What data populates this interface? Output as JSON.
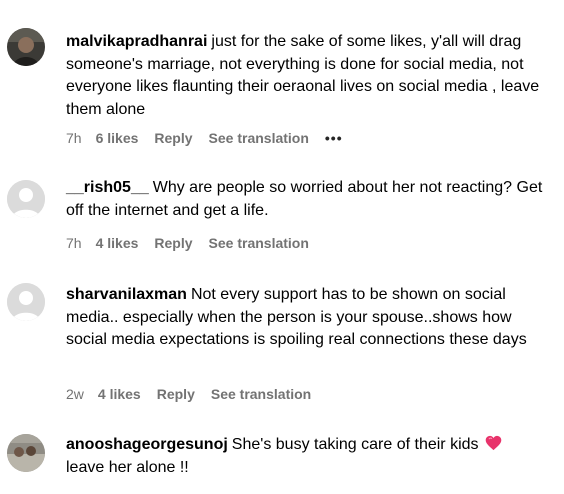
{
  "comments": [
    {
      "username": "malvikapradhanrai",
      "text": "just for the sake of some likes, y'all will drag someone's marriage, not everything is done for social media, not everyone likes flaunting their oeraonal lives on social media , leave them alone",
      "time": "7h",
      "likes": "6 likes",
      "reply": "Reply",
      "translate": "See translation",
      "more": "•••",
      "avatar": "photo"
    },
    {
      "username": "__rish05__",
      "text": "Why are people so worried about her not reacting? Get off the internet and get a life.",
      "time": "7h",
      "likes": "4 likes",
      "reply": "Reply",
      "translate": "See translation",
      "avatar": "default"
    },
    {
      "username": "sharvanilaxman",
      "text": "Not every support has to be shown on social media.. especially when the person is your spouse..shows how social media expectations is spoiling real connections these days",
      "time": "2w",
      "likes": "4 likes",
      "reply": "Reply",
      "translate": "See translation",
      "avatar": "default"
    },
    {
      "username": "anooshageorgesunoj",
      "text": "She's busy taking care of their kids",
      "text_after": "leave her alone !!",
      "emoji": "heart-icon",
      "avatar": "photo"
    }
  ],
  "colors": {
    "meta_text": "#737373",
    "default_avatar_bg": "#dbdbdb",
    "heart": "#e8336b"
  }
}
